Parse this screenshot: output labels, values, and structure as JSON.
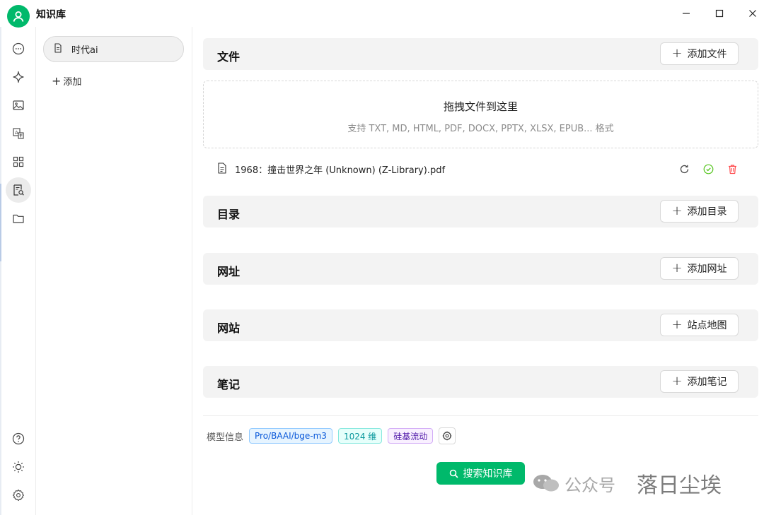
{
  "app": {
    "title": "知识库"
  },
  "sidebar": {
    "items": [
      {
        "icon": "chat-bubble-icon"
      },
      {
        "icon": "sparkle-icon"
      },
      {
        "icon": "image-icon"
      },
      {
        "icon": "translate-icon"
      },
      {
        "icon": "apps-grid-icon"
      },
      {
        "icon": "knowledge-search-icon",
        "active": true
      },
      {
        "icon": "folder-icon"
      }
    ],
    "bottom": [
      {
        "icon": "help-icon"
      },
      {
        "icon": "theme-sun-icon"
      },
      {
        "icon": "settings-icon"
      }
    ]
  },
  "kb_list": {
    "items": [
      {
        "label": "时代ai"
      }
    ],
    "add_label": "添加"
  },
  "sections": {
    "files": {
      "title": "文件",
      "button": "添加文件"
    },
    "dirs": {
      "title": "目录",
      "button": "添加目录"
    },
    "urls": {
      "title": "网址",
      "button": "添加网址"
    },
    "sites": {
      "title": "网站",
      "button": "站点地图"
    },
    "notes": {
      "title": "笔记",
      "button": "添加笔记"
    }
  },
  "dropzone": {
    "title": "拖拽文件到这里",
    "subtitle": "支持 TXT, MD, HTML, PDF, DOCX, PPTX, XLSX, EPUB... 格式"
  },
  "files": [
    {
      "name": "1968：撞击世界之年 (Unknown) (Z-Library).pdf"
    }
  ],
  "model": {
    "label": "模型信息",
    "name": "Pro/BAAI/bge-m3",
    "dims": "1024 维",
    "provider": "硅基流动"
  },
  "search_button": "搜索知识库",
  "watermark": {
    "text1": "公众号",
    "text2": "落日尘埃"
  },
  "colors": {
    "accent": "#00b96b",
    "danger": "#ff4d4f",
    "success": "#52c41a"
  }
}
